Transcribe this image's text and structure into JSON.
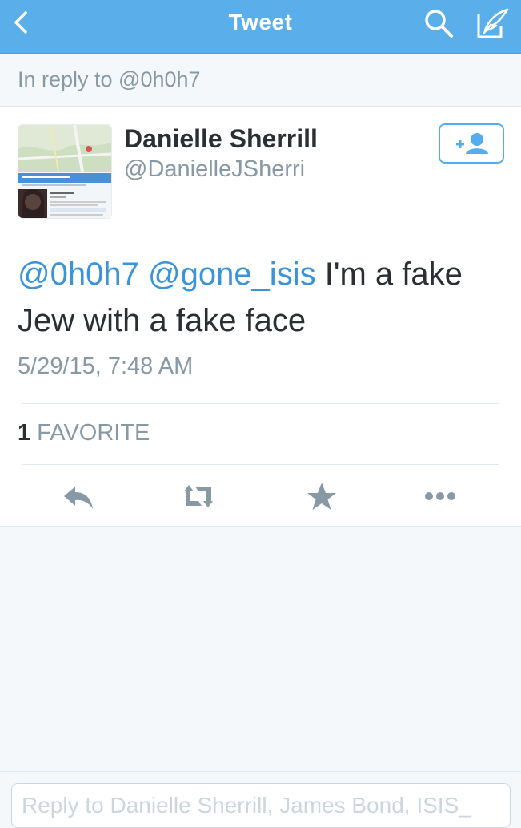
{
  "nav": {
    "title": "Tweet",
    "back_icon": "chevron-left-icon",
    "search_icon": "search-icon",
    "compose_icon": "compose-icon"
  },
  "reply_context": "In reply to @0h0h7",
  "tweet": {
    "author": {
      "name": "Danielle Sherrill",
      "handle": "@DanielleJSherri",
      "follow_icon": "add-user-icon"
    },
    "text": {
      "mention1": "@0h0h7",
      "mention2": "@gone_isis",
      "body": "I'm a fake Jew with a fake face"
    },
    "timestamp": "5/29/15, 7:48 AM",
    "stats": {
      "count": "1",
      "label": "FAVORITE"
    },
    "actions": [
      "reply-icon",
      "retweet-icon",
      "favorite-icon",
      "more-icon"
    ]
  },
  "reply_box": {
    "placeholder": "Reply to Danielle Sherrill, James Bond, ISIS_"
  },
  "colors": {
    "navbar": "#5aaee9",
    "link": "#3b94d9",
    "muted": "#8899a6",
    "text": "#292f33"
  }
}
